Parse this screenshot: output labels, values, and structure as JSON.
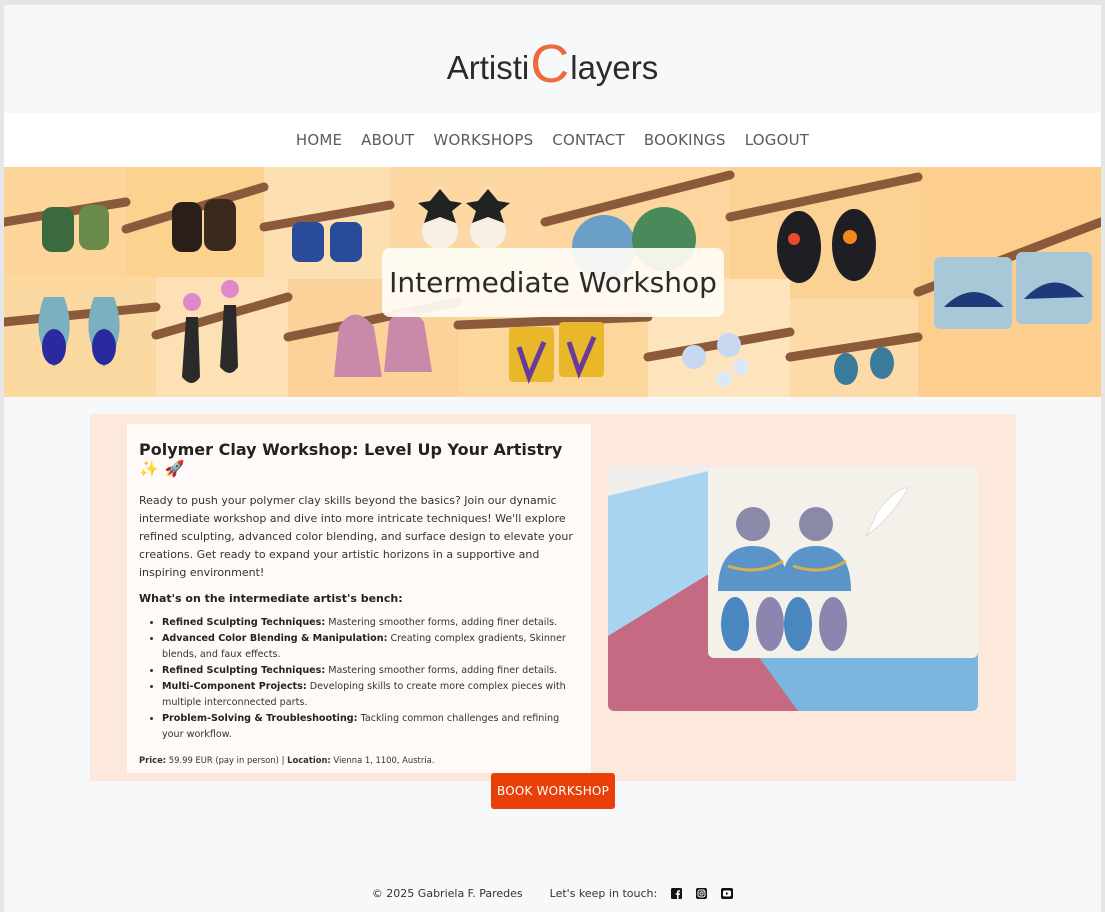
{
  "logo": {
    "part1": "Artisti",
    "big_c": "C",
    "part2": "layers"
  },
  "nav": {
    "items": [
      {
        "label": "HOME"
      },
      {
        "label": "ABOUT"
      },
      {
        "label": "WORKSHOPS"
      },
      {
        "label": "CONTACT"
      },
      {
        "label": "BOOKINGS"
      },
      {
        "label": "LOGOUT"
      }
    ]
  },
  "hero": {
    "title": "Intermediate Workshop"
  },
  "workshop": {
    "heading": "Polymer Clay Workshop: Level Up Your Artistry ✨ 🚀",
    "intro": "Ready to push your polymer clay skills beyond the basics? Join our dynamic intermediate workshop and dive into more intricate techniques! We'll explore refined sculpting, advanced color blending, and surface design to elevate your creations. Get ready to expand your artistic horizons in a supportive and inspiring environment!",
    "bench_heading": "What's on the intermediate artist's bench:",
    "items": [
      {
        "title": "Refined Sculpting Techniques:",
        "text": " Mastering smoother forms, adding finer details."
      },
      {
        "title": "Advanced Color Blending & Manipulation:",
        "text": " Creating complex gradients, Skinner blends, and faux effects."
      },
      {
        "title": "Refined Sculpting Techniques:",
        "text": " Mastering smoother forms, adding finer details."
      },
      {
        "title": "Multi-Component Projects:",
        "text": " Developing skills to create more complex pieces with multiple interconnected parts."
      },
      {
        "title": "Problem-Solving & Troubleshooting:",
        "text": " Tackling common challenges and refining your workflow."
      }
    ],
    "price_label": "Price:",
    "price_value": " 59.99 EUR (pay in person) | ",
    "location_label": "Location:",
    "location_value": " Vienna 1, 1100, Austria."
  },
  "book_button": "BOOK WORKSHOP",
  "footer": {
    "copyright": "© 2025 Gabriela F. Paredes",
    "touch": "Let's keep in touch:",
    "social_icons": [
      "facebook-icon",
      "instagram-icon",
      "youtube-icon"
    ]
  },
  "colors": {
    "accent": "#e84008",
    "logo_c": "#ee6a3c",
    "content_bg": "#fde9dc",
    "hero_bg": "#fcd7a0"
  }
}
